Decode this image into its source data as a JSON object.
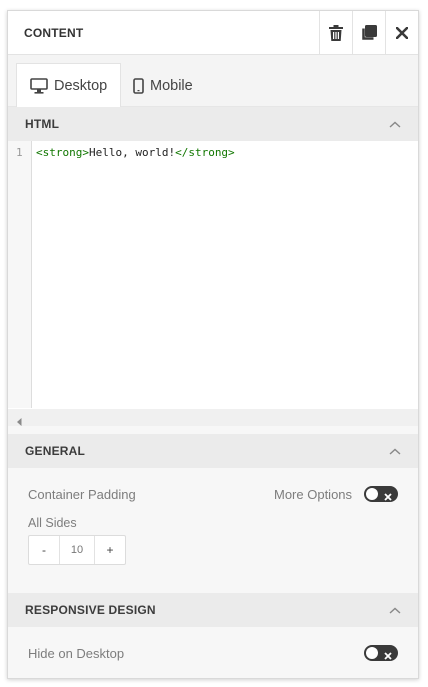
{
  "header": {
    "title": "CONTENT",
    "actions": [
      "trash-icon",
      "duplicate-icon",
      "close-icon"
    ]
  },
  "tabs": [
    {
      "label": "Desktop",
      "icon": "monitor-icon",
      "active": true
    },
    {
      "label": "Mobile",
      "icon": "mobile-icon",
      "active": false
    }
  ],
  "html_section": {
    "title": "HTML",
    "editor": {
      "line_number": "1",
      "open_tag": "<strong>",
      "text": "Hello, world!",
      "close_tag": "</strong>"
    }
  },
  "general": {
    "title": "GENERAL",
    "container_padding_label": "Container Padding",
    "more_options_label": "More Options",
    "more_options_on": false,
    "all_sides_label": "All Sides",
    "padding": {
      "minus": "-",
      "value": "10",
      "plus": "+"
    }
  },
  "responsive": {
    "title": "RESPONSIVE DESIGN",
    "hide_on_desktop_label": "Hide on Desktop",
    "hide_on_desktop_on": false
  },
  "colors": {
    "toggle_bg": "#3a3a3a",
    "tag_color": "#117700",
    "section_bg": "#ebebeb"
  }
}
